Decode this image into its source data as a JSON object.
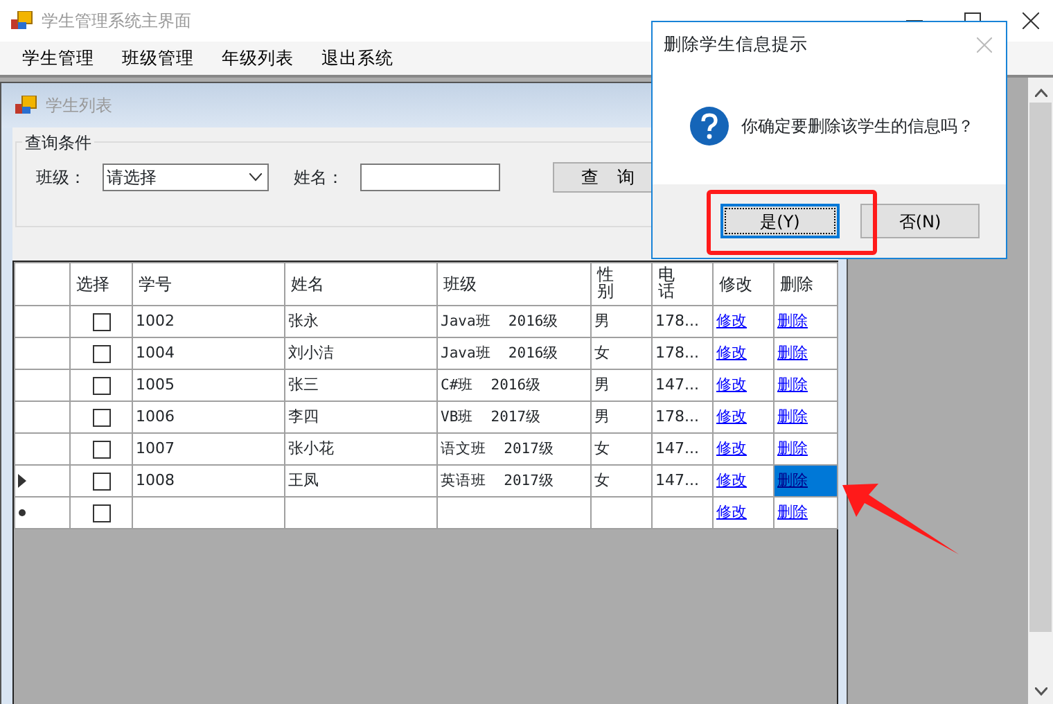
{
  "window": {
    "title": "学生管理系统主界面"
  },
  "menu": [
    {
      "label": "学生管理"
    },
    {
      "label": "班级管理"
    },
    {
      "label": "年级列表"
    },
    {
      "label": "退出系统"
    }
  ],
  "child_window": {
    "title": "学生列表",
    "query": {
      "legend": "查询条件",
      "class_label": "班级：",
      "class_value": "请选择",
      "name_label": "姓名：",
      "button": "查　询"
    },
    "table": {
      "columns": [
        {
          "label": "选择",
          "stacked": false
        },
        {
          "label": "学号",
          "stacked": false
        },
        {
          "label": "姓名",
          "stacked": false
        },
        {
          "label": "班级",
          "stacked": false
        },
        {
          "label": "性别",
          "stacked": true
        },
        {
          "label": "电话",
          "stacked": true
        },
        {
          "label": "修改",
          "stacked": false
        },
        {
          "label": "删除",
          "stacked": false
        }
      ],
      "rows": [
        {
          "kind": "data",
          "checked": false,
          "id": "1002",
          "name": "张永",
          "class": "Java班  2016级",
          "sex": "男",
          "phone": "178...",
          "edit": "修改",
          "delete": "删除",
          "selected": false
        },
        {
          "kind": "data",
          "checked": false,
          "id": "1004",
          "name": "刘小洁",
          "class": "Java班  2016级",
          "sex": "女",
          "phone": "178...",
          "edit": "修改",
          "delete": "删除",
          "selected": false
        },
        {
          "kind": "data",
          "checked": false,
          "id": "1005",
          "name": "张三",
          "class": "C#班  2016级",
          "sex": "男",
          "phone": "147...",
          "edit": "修改",
          "delete": "删除",
          "selected": false
        },
        {
          "kind": "data",
          "checked": false,
          "id": "1006",
          "name": "李四",
          "class": "VB班  2017级",
          "sex": "男",
          "phone": "178...",
          "edit": "修改",
          "delete": "删除",
          "selected": false
        },
        {
          "kind": "data",
          "checked": false,
          "id": "1007",
          "name": "张小花",
          "class": "语文班  2017级",
          "sex": "女",
          "phone": "147...",
          "edit": "修改",
          "delete": "删除",
          "selected": false
        },
        {
          "kind": "data",
          "checked": false,
          "id": "1008",
          "name": "王凤",
          "class": "英语班  2017级",
          "sex": "女",
          "phone": "147...",
          "edit": "修改",
          "delete": "删除",
          "selected": true
        },
        {
          "kind": "new",
          "checked": false,
          "edit": "修改",
          "delete": "删除",
          "selected": false
        }
      ]
    }
  },
  "dialog": {
    "title": "删除学生信息提示",
    "message": "你确定要删除该学生的信息吗？",
    "buttons": [
      {
        "label": "是(Y)",
        "focused": true
      },
      {
        "label": "否(N)",
        "focused": false
      }
    ]
  }
}
